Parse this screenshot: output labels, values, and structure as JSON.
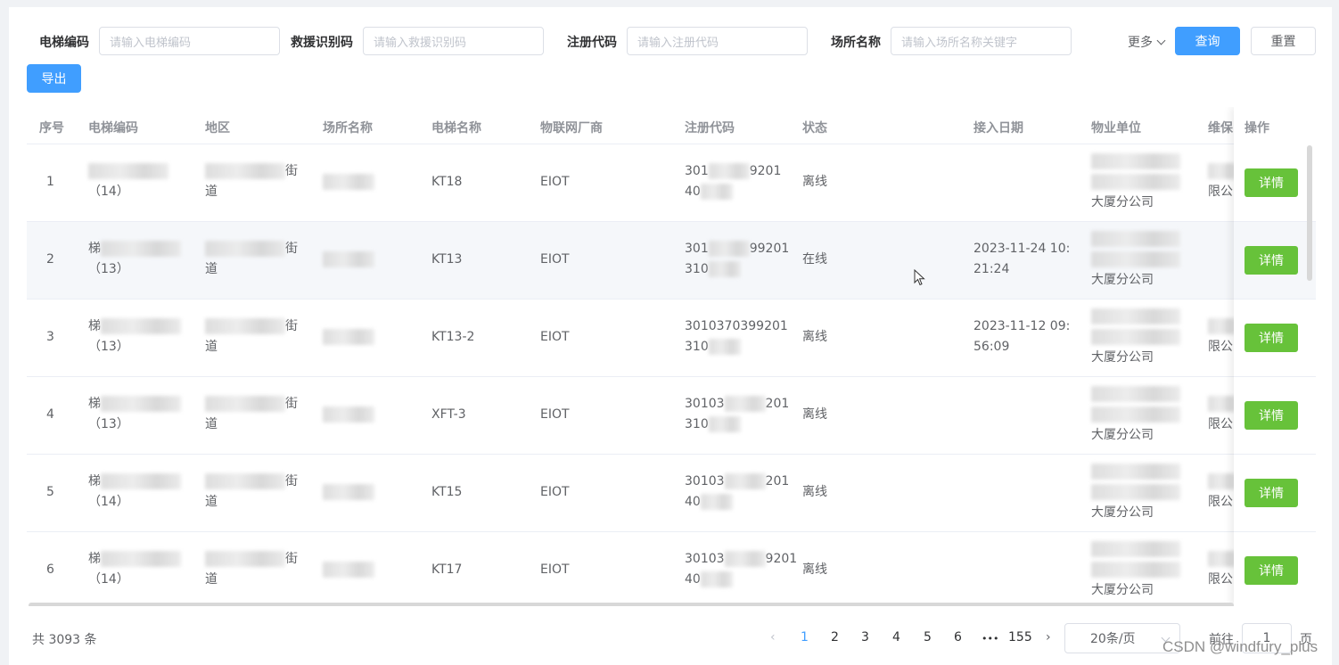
{
  "filters": [
    {
      "label": "电梯编码",
      "placeholder": "请输入电梯编码"
    },
    {
      "label": "救援识别码",
      "placeholder": "请输入救援识别码"
    },
    {
      "label": "注册代码",
      "placeholder": "请输入注册代码"
    },
    {
      "label": "场所名称",
      "placeholder": "请输入场所名称关键字"
    }
  ],
  "toolbar": {
    "more_label": "更多",
    "query_label": "查询",
    "reset_label": "重置",
    "export_label": "导出"
  },
  "table": {
    "headers": [
      "序号",
      "电梯编码",
      "地区",
      "场所名称",
      "电梯名称",
      "物联网厂商",
      "注册代码",
      "状态",
      "接入日期",
      "物业单位",
      "维保",
      "操作"
    ],
    "action_label": "详情",
    "rows": [
      {
        "no": "1",
        "code_pre": "",
        "code_suf": "（14）",
        "area": "道",
        "area_tail": "街",
        "name": "KT18",
        "vendor": "EIOT",
        "reg1": "301",
        "reg1b": "9201",
        "reg2": "40",
        "status": "离线",
        "date1": "",
        "date2": "",
        "prop": "大厦分公司",
        "maint": "限公"
      },
      {
        "no": "2",
        "code_pre": "梯",
        "code_suf": "（13）",
        "area": "道",
        "area_tail": "街",
        "name": "KT13",
        "vendor": "EIOT",
        "reg1": "301",
        "reg1b": "99201",
        "reg2": "310",
        "status": "在线",
        "date1": "2023-11-24 10:",
        "date2": "21:24",
        "prop": "大厦分公司",
        "maint": ""
      },
      {
        "no": "3",
        "code_pre": "梯",
        "code_suf": "（13）",
        "area": "道",
        "area_tail": "街",
        "name": "KT13-2",
        "vendor": "EIOT",
        "reg1": "3010370399201",
        "reg1b": "",
        "reg2": "310",
        "status": "离线",
        "date1": "2023-11-12 09:",
        "date2": "56:09",
        "prop": "大厦分公司",
        "maint": "限公"
      },
      {
        "no": "4",
        "code_pre": "梯",
        "code_suf": "（13）",
        "area": "道",
        "area_tail": "街",
        "name": "XFT-3",
        "vendor": "EIOT",
        "reg1": "30103",
        "reg1b": "201",
        "reg2": "310",
        "status": "离线",
        "date1": "",
        "date2": "",
        "prop": "大厦分公司",
        "maint": "限公"
      },
      {
        "no": "5",
        "code_pre": "梯",
        "code_suf": "（14）",
        "area": "道",
        "area_tail": "街",
        "name": "KT15",
        "vendor": "EIOT",
        "reg1": "30103",
        "reg1b": "201",
        "reg2": "40",
        "status": "离线",
        "date1": "",
        "date2": "",
        "prop": "大厦分公司",
        "maint": "限公"
      },
      {
        "no": "6",
        "code_pre": "梯",
        "code_suf": "（14）",
        "area": "道",
        "area_tail": "街",
        "name": "KT17",
        "vendor": "EIOT",
        "reg1": "30103",
        "reg1b": "9201",
        "reg2": "40",
        "status": "离线",
        "date1": "",
        "date2": "",
        "prop": "大厦分公司",
        "maint": "限公"
      }
    ]
  },
  "pagination": {
    "total": "共 3093 条",
    "pages": [
      "1",
      "2",
      "3",
      "4",
      "5",
      "6"
    ],
    "ellipsis": "•••",
    "last_page": "155",
    "page_size": "20条/页",
    "goto_prefix": "前往",
    "goto_value": "1",
    "goto_suffix": "页"
  },
  "watermark": "CSDN @windfury_plus"
}
